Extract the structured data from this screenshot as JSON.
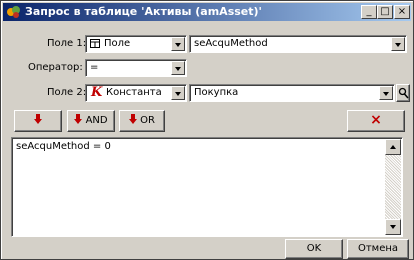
{
  "window": {
    "title": "Запрос в таблице 'Активы (amAsset)'",
    "minimize_label": "_",
    "maximize_label": "□",
    "close_label": "×"
  },
  "form": {
    "field1": {
      "label": "Поле 1:",
      "type_value": "Поле",
      "value": "seAcquMethod"
    },
    "operator": {
      "label": "Оператор:",
      "value": "="
    },
    "field2": {
      "label": "Поле 2:",
      "type_value": "Константа",
      "type_icon_text": "K",
      "value": "Покупка"
    }
  },
  "toolbar": {
    "and_label": "AND",
    "or_label": "OR",
    "delete_label": "×"
  },
  "editor": {
    "text": "seAcquMethod = 0"
  },
  "footer": {
    "ok_label": "OK",
    "cancel_label": "Отмена"
  },
  "colors": {
    "title_start": "#0a246a",
    "title_end": "#a6caf0",
    "face": "#d4d0c8",
    "accent_red": "#c00000"
  }
}
